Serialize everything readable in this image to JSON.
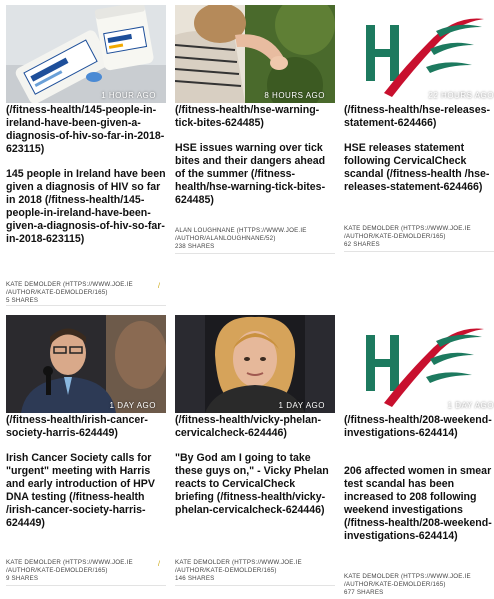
{
  "cards": [
    {
      "time": "1 HOUR AGO",
      "link": "(/fitness-health/145-people-in-ireland-have-been-given-a-diagnosis-of-hiv-so-far-in-2018-623115)",
      "headline": "145 people in Ireland have been given a diagnosis of HIV so far in 2018 (/fitness-health/145-people-in-ireland-have-been-given-a-diagnosis-of-hiv-so-far-in-2018-623115)",
      "author": "KATE DEMOLDER (HTTPS://WWW.JOE.IE /AUTHOR/KATE-DEMOLDER/165)",
      "shares": "5 SHARES"
    },
    {
      "time": "8 HOURS AGO",
      "link": "(/fitness-health/hse-warning-tick-bites-624485)",
      "headline": "HSE issues warning over tick bites and their dangers ahead of the summer (/fitness-health/hse-warning-tick-bites-624485)",
      "author": "ALAN LOUGHNANE (HTTPS://WWW.JOE.IE /AUTHOR/ALANLOUGHNANE/52)",
      "shares": "238 SHARES"
    },
    {
      "time": "22 HOURS AGO",
      "link": "(/fitness-health/hse-releases-statement-624466)",
      "headline": "HSE releases statement following CervicalCheck scandal (/fitness-health /hse-releases-statement-624466)",
      "author": "KATE DEMOLDER (HTTPS://WWW.JOE.IE /AUTHOR/KATE-DEMOLDER/165)",
      "shares": "62 SHARES"
    },
    {
      "time": "1 DAY AGO",
      "link": "(/fitness-health/irish-cancer-society-harris-624449)",
      "headline": "Irish Cancer Society calls for \"urgent\" meeting with Harris and early introduction of HPV DNA testing (/fitness-health /irish-cancer-society-harris-624449)",
      "author": "KATE DEMOLDER (HTTPS://WWW.JOE.IE /AUTHOR/KATE-DEMOLDER/165)",
      "shares": "9 SHARES"
    },
    {
      "time": "1 DAY AGO",
      "link": "(/fitness-health/vicky-phelan-cervicalcheck-624446)",
      "headline": "\"By God am I going to take these guys on,\" - Vicky Phelan reacts to CervicalCheck briefing (/fitness-health/vicky-phelan-cervicalcheck-624446)",
      "author": "KATE DEMOLDER (HTTPS://WWW.JOE.IE /AUTHOR/KATE-DEMOLDER/165)",
      "shares": "146 SHARES"
    },
    {
      "time": "1 DAY AGO",
      "link": "(/fitness-health/208-weekend-investigations-624414)",
      "headline": "206 affected women in smear test scandal has been increased to 208 following weekend investigations (/fitness-health/208-weekend-investigations-624414)",
      "author": "KATE DEMOLDER (HTTPS://WWW.JOE.IE /AUTHOR/KATE-DEMOLDER/165)",
      "shares": "677 SHARES"
    }
  ],
  "colors": {
    "hse_green": "#1d7a5f",
    "hse_red": "#c8102e",
    "tick": "#c8a200"
  }
}
